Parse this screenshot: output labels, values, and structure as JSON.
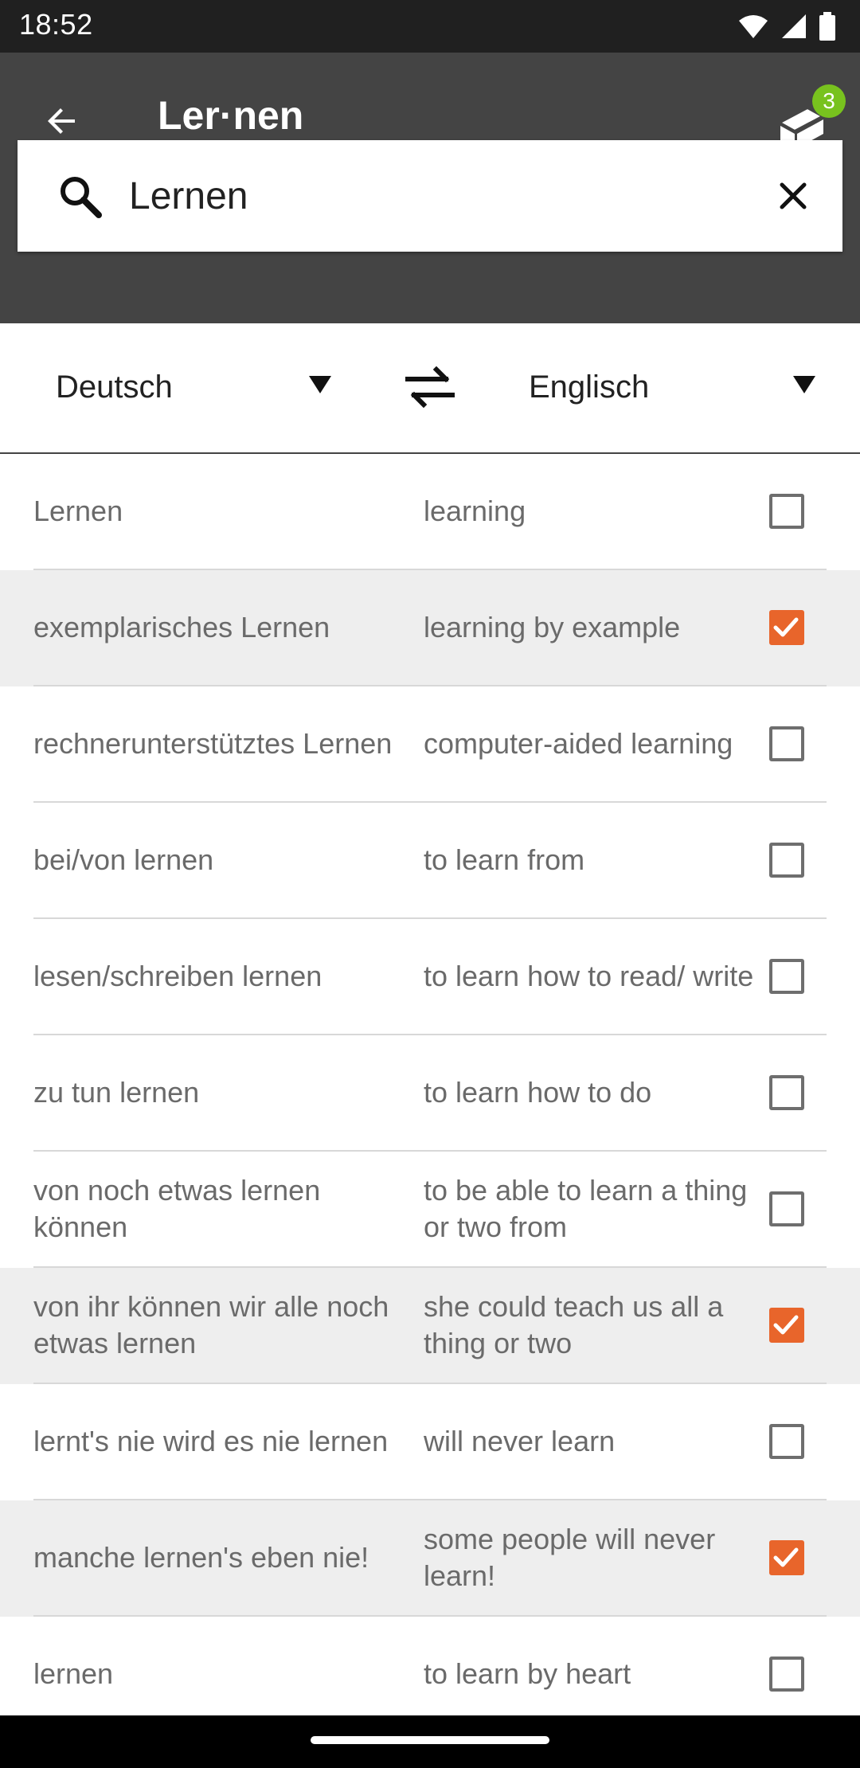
{
  "status_bar": {
    "time": "18:52",
    "icons": [
      "wifi-icon",
      "signal-icon",
      "battery-icon"
    ]
  },
  "app_bar": {
    "title": "Ler·nen",
    "back_icon": "arrow-left-icon",
    "cards_badge": "3"
  },
  "search": {
    "value": "Lernen",
    "placeholder": ""
  },
  "languages": {
    "source": "Deutsch",
    "target": "Englisch"
  },
  "colors": {
    "accent": "#e8652b",
    "appbar": "#444444",
    "badge": "#78c21e"
  },
  "entries": [
    {
      "src": "Lernen",
      "dst": "learning",
      "checked": false
    },
    {
      "src": "exemplarisches Lernen",
      "dst": "learning by example",
      "checked": true
    },
    {
      "src": "rechnerunterstütztes Lernen",
      "dst": "computer-aided learning",
      "checked": false
    },
    {
      "src": "bei/von  lernen",
      "dst": "to learn  from",
      "checked": false
    },
    {
      "src": "lesen/schreiben lernen",
      "dst": "to learn how to read/ write",
      "checked": false
    },
    {
      "src": "zu tun lernen",
      "dst": "to learn how to do",
      "checked": false
    },
    {
      "src": "von  noch etwas lernen können",
      "dst": "to be able to learn a thing or two from",
      "checked": false
    },
    {
      "src": "von ihr können wir alle noch etwas lernen",
      "dst": "she could teach us all a thing or two",
      "checked": true
    },
    {
      "src": "lernt's nie wird es nie lernen",
      "dst": "will never learn",
      "checked": false
    },
    {
      "src": "manche lernen's eben nie!",
      "dst": "some people will never learn!",
      "checked": true
    },
    {
      "src": "lernen",
      "dst": "to learn  by heart",
      "checked": false
    }
  ]
}
